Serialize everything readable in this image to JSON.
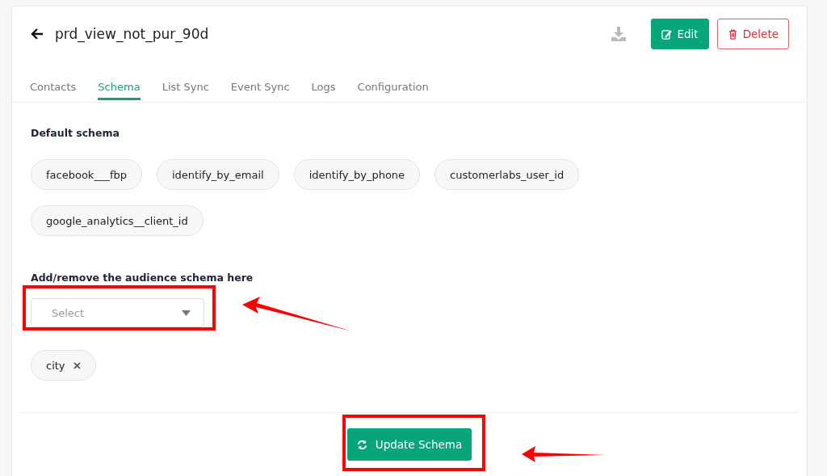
{
  "header": {
    "title": "prd_view_not_pur_90d",
    "buttons": [
      {
        "kind": "edit",
        "label": "Edit"
      },
      {
        "kind": "delete",
        "label": "Delete"
      }
    ]
  },
  "tabs": [
    {
      "label": "Contacts",
      "selected": false
    },
    {
      "label": "Schema",
      "selected": true
    },
    {
      "label": "List Sync",
      "selected": false
    },
    {
      "label": "Event Sync",
      "selected": false
    },
    {
      "label": "Logs",
      "selected": false
    },
    {
      "label": "Configuration",
      "selected": false
    }
  ],
  "default_schema": {
    "heading": "Default schema",
    "chips": [
      "facebook___fbp",
      "identify_by_email",
      "identify_by_phone",
      "customerlabs_user_id",
      "google_analytics__client_id"
    ]
  },
  "audience_schema": {
    "heading": "Add/remove the audience schema here",
    "select": {
      "placeholder": "Select"
    },
    "chips": [
      "city"
    ]
  },
  "footer": {
    "button": "Update Schema"
  }
}
